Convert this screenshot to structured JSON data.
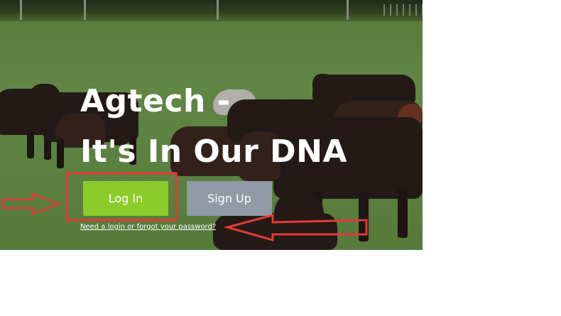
{
  "hero": {
    "headline_line1": "Agtech -",
    "headline_line2": "It's In Our DNA"
  },
  "actions": {
    "login_label": "Log In",
    "signup_label": "Sign Up",
    "help_link": "Need a login or forgot your password?"
  },
  "colors": {
    "login_button": "#8ccc2a",
    "signup_button": "#8f9aa5",
    "annotation": "#e53935",
    "page_background": "#ffffff"
  },
  "annotations": {
    "highlight_box_target": "login-button",
    "arrow_1_target": "login-button",
    "arrow_2_target": "help-link"
  }
}
